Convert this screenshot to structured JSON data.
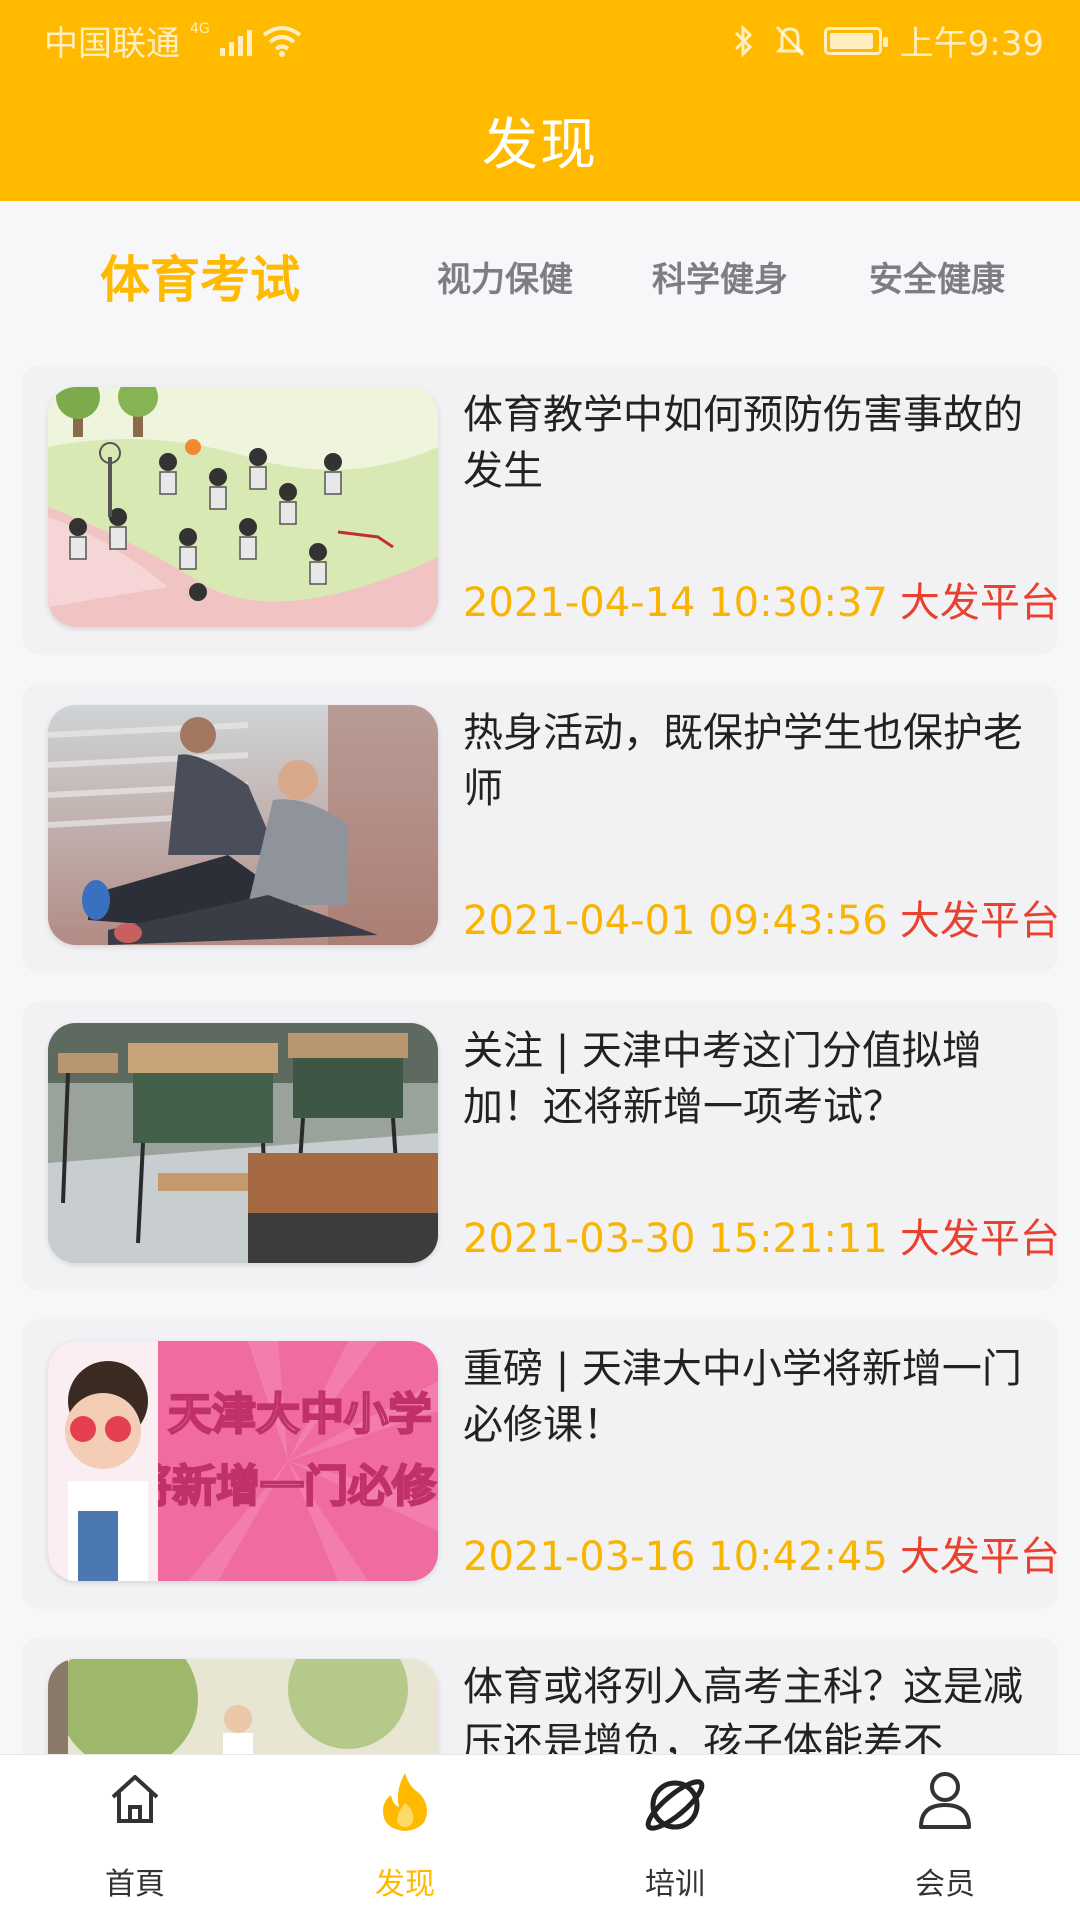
{
  "status_bar": {
    "carrier": "中国联通",
    "network": "4G",
    "time": "上午9:39",
    "battery_level": 0.95
  },
  "header": {
    "title": "发现",
    "bg_color": "#ffba00"
  },
  "tabs": [
    {
      "label": "体育考试",
      "active": true
    },
    {
      "label": "视力保健",
      "active": false
    },
    {
      "label": "科学健身",
      "active": false
    },
    {
      "label": "安全健康",
      "active": false
    }
  ],
  "articles": [
    {
      "title": "体育教学中如何预防伤害事故的发生",
      "date": "2021-04-14 10:30:37",
      "source": "大发平台",
      "thumbnail_icon": "playground-illustration"
    },
    {
      "title": "热身活动，既保护学生也保护老师",
      "date": "2021-04-01 09:43:56",
      "source": "大发平台",
      "thumbnail_icon": "stretching-photo"
    },
    {
      "title": "关注 | 天津中考这门分值拟增加！还将新增一项考试？",
      "date": "2021-03-30 15:21:11",
      "source": "大发平台",
      "thumbnail_icon": "classroom-desks-photo"
    },
    {
      "title": "重磅 | 天津大中小学将新增一门必修课！",
      "date": "2021-03-16 10:42:45",
      "source": "大发平台",
      "thumbnail_icon": "pink-banner-photo",
      "thumb_text_1": "天津大中小学",
      "thumb_text_2": "将新增一门必修"
    },
    {
      "title": "体育或将列入高考主科？这是减压还是增负，孩子体能差不",
      "date": "",
      "source": "",
      "thumbnail_icon": "park-photo"
    }
  ],
  "bottom_nav": [
    {
      "label": "首頁",
      "icon": "home-icon",
      "active": false
    },
    {
      "label": "发现",
      "icon": "fire-icon",
      "active": true
    },
    {
      "label": "培训",
      "icon": "planet-icon",
      "active": false
    },
    {
      "label": "会员",
      "icon": "user-icon",
      "active": false
    }
  ],
  "colors": {
    "accent": "#ffba00",
    "date": "#f8b400",
    "source": "#e8412f",
    "text": "#222222",
    "tab_inactive": "#7d7d85"
  }
}
